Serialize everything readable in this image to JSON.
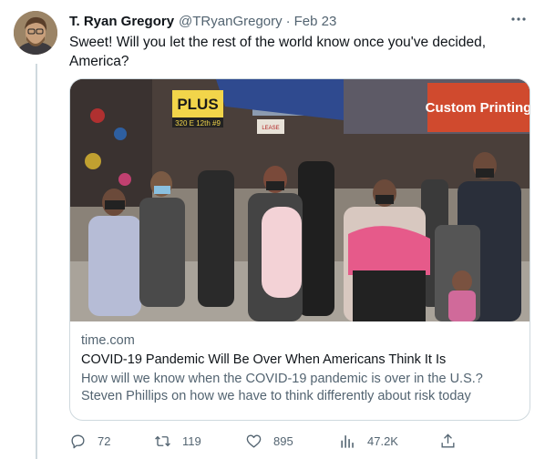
{
  "tweet": {
    "author_name": "T. Ryan Gregory",
    "handle": "@TRyanGregory",
    "separator": "·",
    "date": "Feb 23",
    "text": "Sweet! Will you let the rest of the world know once you've decided, America?"
  },
  "card": {
    "domain": "time.com",
    "title": "COVID-19 Pandemic Will Be Over When Americans Think It Is",
    "description": "How will we know when the COVID-19 pandemic is over in the U.S.? Steven Phillips on how we have to think differently about risk today",
    "image_signs": {
      "store_sign": "PLUS",
      "store_address": "320 E 12th #9",
      "right_sign": "Custom Printing",
      "small_sign": "LEASE"
    }
  },
  "actions": {
    "reply_count": "72",
    "retweet_count": "119",
    "like_count": "895",
    "views_count": "47.2K"
  },
  "icons": [
    "more-icon",
    "reply-icon",
    "retweet-icon",
    "like-icon",
    "views-icon",
    "share-icon"
  ],
  "colors": {
    "text": "#0f1419",
    "secondary": "#536471",
    "border": "#cfd9de"
  }
}
